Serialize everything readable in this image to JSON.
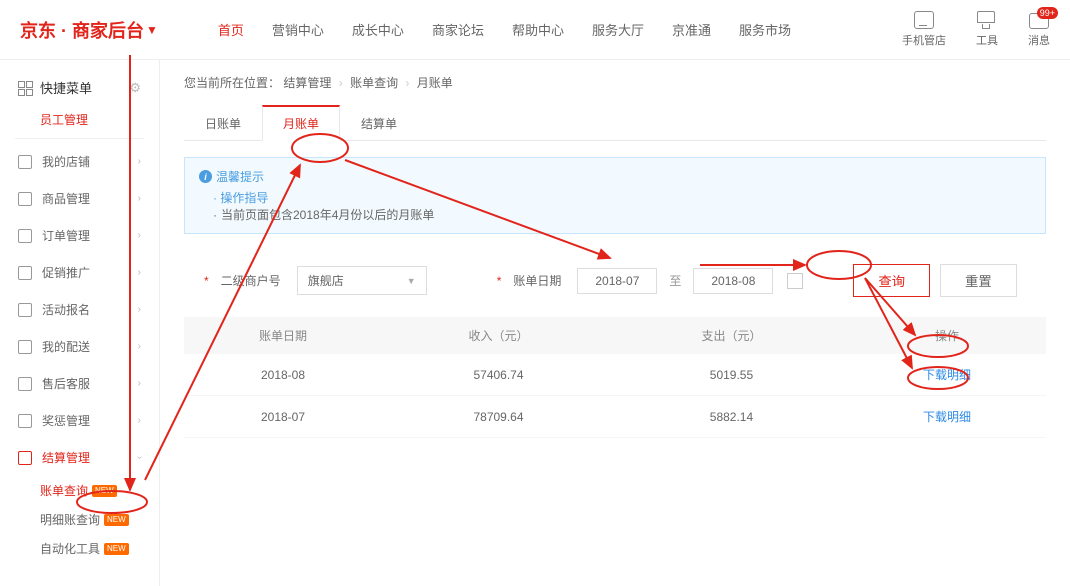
{
  "header": {
    "logo": "京东 · 商家后台",
    "nav": [
      "首页",
      "营销中心",
      "成长中心",
      "商家论坛",
      "帮助中心",
      "服务大厅",
      "京准通",
      "服务市场"
    ],
    "nav_active": 0,
    "right": {
      "phone": "手机管店",
      "tool": "工具",
      "msg": "消息",
      "msg_badge": "99+"
    }
  },
  "sidebar": {
    "quick_menu": "快捷菜单",
    "staff": "员工管理",
    "items": [
      {
        "icon": "shop",
        "label": "我的店铺"
      },
      {
        "icon": "goods",
        "label": "商品管理"
      },
      {
        "icon": "order",
        "label": "订单管理"
      },
      {
        "icon": "promo",
        "label": "促销推广"
      },
      {
        "icon": "activity",
        "label": "活动报名"
      },
      {
        "icon": "delivery",
        "label": "我的配送"
      },
      {
        "icon": "service",
        "label": "售后客服"
      },
      {
        "icon": "reward",
        "label": "奖惩管理"
      },
      {
        "icon": "settle",
        "label": "结算管理"
      }
    ],
    "active_item": 8,
    "sub_items": [
      {
        "label": "账单查询",
        "new": true,
        "active": true
      },
      {
        "label": "明细账查询",
        "new": true,
        "active": false
      },
      {
        "label": "自动化工具",
        "new": true,
        "active": false
      }
    ]
  },
  "breadcrumb": {
    "prefix": "您当前所在位置：",
    "parts": [
      "结算管理",
      "账单查询",
      "月账单"
    ]
  },
  "tabs": {
    "items": [
      "日账单",
      "月账单",
      "结算单"
    ],
    "active": 1
  },
  "tip": {
    "title": "温馨提示",
    "link": "操作指导",
    "note": "当前页面包含2018年4月份以后的月账单"
  },
  "filter": {
    "merchant_label": "二级商户号",
    "merchant_value": "旗舰店",
    "date_label": "账单日期",
    "date_from": "2018-07",
    "date_sep": "至",
    "date_to": "2018-08",
    "query": "查询",
    "reset": "重置"
  },
  "table": {
    "cols": [
      "账单日期",
      "收入（元）",
      "支出（元）",
      "操作"
    ],
    "rows": [
      {
        "date": "2018-08",
        "income": "57406.74",
        "expense": "5019.55",
        "action": "下载明细"
      },
      {
        "date": "2018-07",
        "income": "78709.64",
        "expense": "5882.14",
        "action": "下载明细"
      }
    ]
  }
}
